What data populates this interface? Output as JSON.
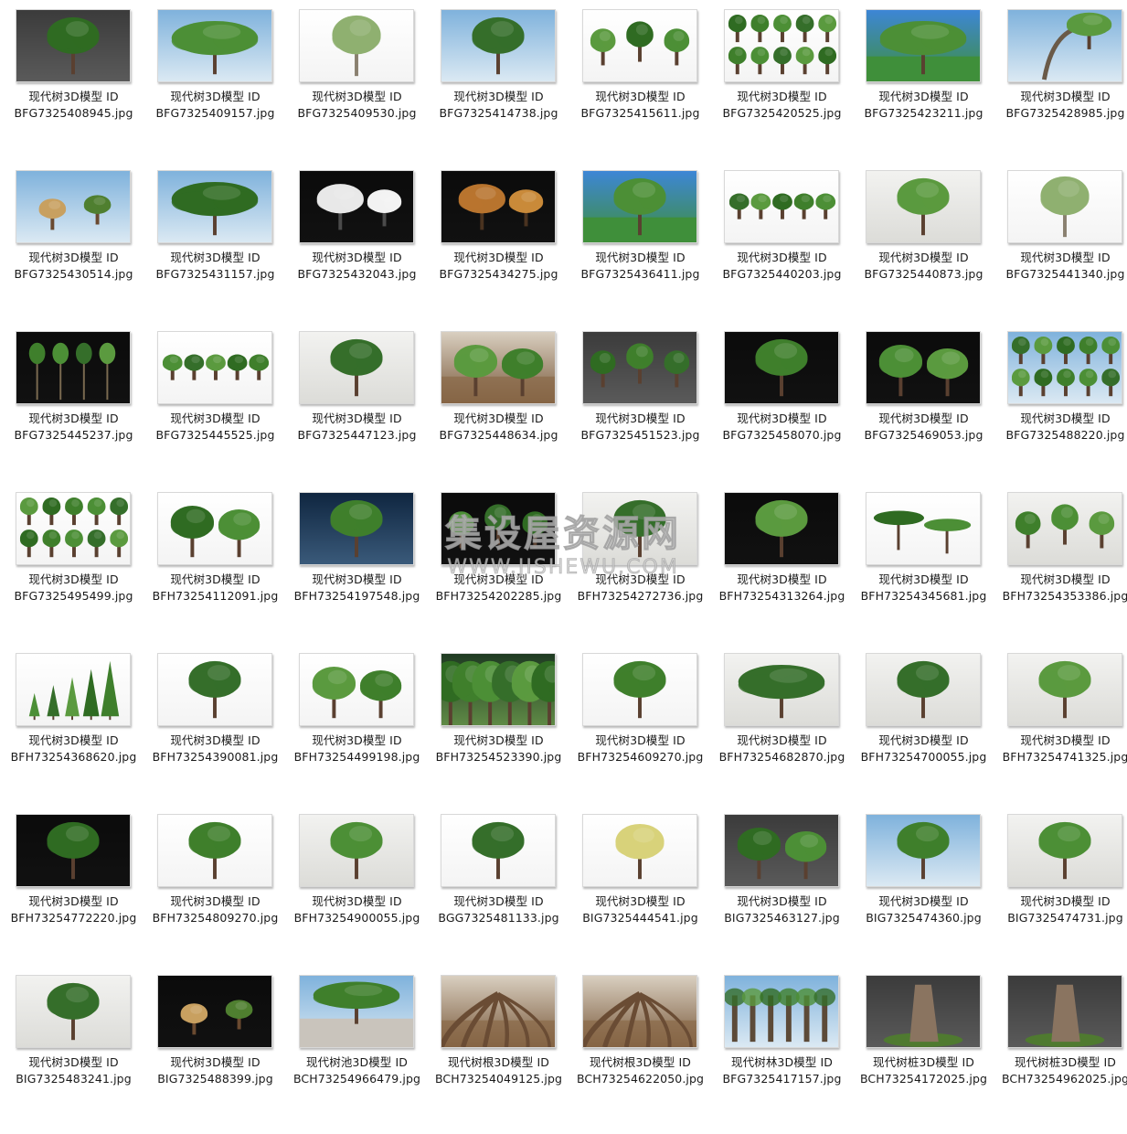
{
  "watermark": {
    "main": "集设屋资源网",
    "url": "WWW.JISHEWU.COM"
  },
  "files": [
    {
      "title": "现代树3D模型 ID",
      "filename": "BFG7325408945.jpg",
      "bg": "dark-grey",
      "tree": "single"
    },
    {
      "title": "现代树3D模型 ID",
      "filename": "BFG7325409157.jpg",
      "bg": "sky",
      "tree": "wide"
    },
    {
      "title": "现代树3D模型 ID",
      "filename": "BFG7325409530.jpg",
      "bg": "white",
      "tree": "willow"
    },
    {
      "title": "现代树3D模型 ID",
      "filename": "BFG7325414738.jpg",
      "bg": "sky",
      "tree": "single"
    },
    {
      "title": "现代树3D模型 ID",
      "filename": "BFG7325415611.jpg",
      "bg": "white",
      "tree": "three"
    },
    {
      "title": "现代树3D模型 ID",
      "filename": "BFG7325420525.jpg",
      "bg": "white",
      "tree": "many"
    },
    {
      "title": "现代树3D模型 ID",
      "filename": "BFG7325423211.jpg",
      "bg": "green-sky",
      "tree": "wide"
    },
    {
      "title": "现代树3D模型 ID",
      "filename": "BFG7325428985.jpg",
      "bg": "sky",
      "tree": "arch"
    },
    {
      "title": "现代树3D模型 ID",
      "filename": "BFG7325430514.jpg",
      "bg": "sky",
      "tree": "bonsai"
    },
    {
      "title": "现代树3D模型 ID",
      "filename": "BFG7325431157.jpg",
      "bg": "sky",
      "tree": "wide"
    },
    {
      "title": "现代树3D模型 ID",
      "filename": "BFG7325432043.jpg",
      "bg": "black",
      "tree": "blossom"
    },
    {
      "title": "现代树3D模型 ID",
      "filename": "BFG7325434275.jpg",
      "bg": "black",
      "tree": "autumn"
    },
    {
      "title": "现代树3D模型 ID",
      "filename": "BFG7325436411.jpg",
      "bg": "green-sky",
      "tree": "single"
    },
    {
      "title": "现代树3D模型 ID",
      "filename": "BFG7325440203.jpg",
      "bg": "white",
      "tree": "row"
    },
    {
      "title": "现代树3D模型 ID",
      "filename": "BFG7325440873.jpg",
      "bg": "light",
      "tree": "single"
    },
    {
      "title": "现代树3D模型 ID",
      "filename": "BFG7325441340.jpg",
      "bg": "white",
      "tree": "willow"
    },
    {
      "title": "现代树3D模型 ID",
      "filename": "BFG7325445237.jpg",
      "bg": "black",
      "tree": "tall"
    },
    {
      "title": "现代树3D模型 ID",
      "filename": "BFG7325445525.jpg",
      "bg": "white",
      "tree": "row"
    },
    {
      "title": "现代树3D模型 ID",
      "filename": "BFG7325447123.jpg",
      "bg": "light",
      "tree": "single"
    },
    {
      "title": "现代树3D模型 ID",
      "filename": "BFG7325448634.jpg",
      "bg": "brown",
      "tree": "two"
    },
    {
      "title": "现代树3D模型 ID",
      "filename": "BFG7325451523.jpg",
      "bg": "dark-grey",
      "tree": "three"
    },
    {
      "title": "现代树3D模型 ID",
      "filename": "BFG7325458070.jpg",
      "bg": "black",
      "tree": "single"
    },
    {
      "title": "现代树3D模型 ID",
      "filename": "BFG7325469053.jpg",
      "bg": "black",
      "tree": "two"
    },
    {
      "title": "现代树3D模型 ID",
      "filename": "BFG7325488220.jpg",
      "bg": "sky",
      "tree": "many"
    },
    {
      "title": "现代树3D模型 ID",
      "filename": "BFG7325495499.jpg",
      "bg": "white",
      "tree": "many"
    },
    {
      "title": "现代树3D模型 ID",
      "filename": "BFH73254112091.jpg",
      "bg": "white",
      "tree": "two"
    },
    {
      "title": "现代树3D模型 ID",
      "filename": "BFH73254197548.jpg",
      "bg": "night",
      "tree": "single"
    },
    {
      "title": "现代树3D模型 ID",
      "filename": "BFH73254202285.jpg",
      "bg": "black",
      "tree": "three"
    },
    {
      "title": "现代树3D模型 ID",
      "filename": "BFH73254272736.jpg",
      "bg": "light",
      "tree": "single"
    },
    {
      "title": "现代树3D模型 ID",
      "filename": "BFH73254313264.jpg",
      "bg": "black",
      "tree": "single"
    },
    {
      "title": "现代树3D模型 ID",
      "filename": "BFH73254345681.jpg",
      "bg": "white",
      "tree": "acacia"
    },
    {
      "title": "现代树3D模型 ID",
      "filename": "BFH73254353386.jpg",
      "bg": "light",
      "tree": "three"
    },
    {
      "title": "现代树3D模型 ID",
      "filename": "BFH73254368620.jpg",
      "bg": "white",
      "tree": "conifer"
    },
    {
      "title": "现代树3D模型 ID",
      "filename": "BFH73254390081.jpg",
      "bg": "white",
      "tree": "single"
    },
    {
      "title": "现代树3D模型 ID",
      "filename": "BFH73254499198.jpg",
      "bg": "white",
      "tree": "two"
    },
    {
      "title": "现代树3D模型 ID",
      "filename": "BFH73254523390.jpg",
      "bg": "jungle",
      "tree": "dense"
    },
    {
      "title": "现代树3D模型 ID",
      "filename": "BFH73254609270.jpg",
      "bg": "white",
      "tree": "single"
    },
    {
      "title": "现代树3D模型 ID",
      "filename": "BFH73254682870.jpg",
      "bg": "light",
      "tree": "wide"
    },
    {
      "title": "现代树3D模型 ID",
      "filename": "BFH73254700055.jpg",
      "bg": "light",
      "tree": "single"
    },
    {
      "title": "现代树3D模型 ID",
      "filename": "BFH73254741325.jpg",
      "bg": "light",
      "tree": "single"
    },
    {
      "title": "现代树3D模型 ID",
      "filename": "BFH73254772220.jpg",
      "bg": "black",
      "tree": "single"
    },
    {
      "title": "现代树3D模型 ID",
      "filename": "BFH73254809270.jpg",
      "bg": "white",
      "tree": "single"
    },
    {
      "title": "现代树3D模型 ID",
      "filename": "BFH73254900055.jpg",
      "bg": "light",
      "tree": "single"
    },
    {
      "title": "现代树3D模型 ID",
      "filename": "BGG7325481133.jpg",
      "bg": "white",
      "tree": "single"
    },
    {
      "title": "现代树3D模型 ID",
      "filename": "BIG7325444541.jpg",
      "bg": "white",
      "tree": "yellow"
    },
    {
      "title": "现代树3D模型 ID",
      "filename": "BIG7325463127.jpg",
      "bg": "dark-grey",
      "tree": "two"
    },
    {
      "title": "现代树3D模型 ID",
      "filename": "BIG7325474360.jpg",
      "bg": "sky",
      "tree": "single"
    },
    {
      "title": "现代树3D模型 ID",
      "filename": "BIG7325474731.jpg",
      "bg": "light",
      "tree": "single"
    },
    {
      "title": "现代树3D模型 ID",
      "filename": "BIG7325483241.jpg",
      "bg": "light",
      "tree": "single"
    },
    {
      "title": "现代树3D模型 ID",
      "filename": "BIG7325488399.jpg",
      "bg": "black",
      "tree": "bonsai"
    },
    {
      "title": "现代树池3D模型 ID",
      "filename": "BCH73254966479.jpg",
      "bg": "sky",
      "tree": "plaza"
    },
    {
      "title": "现代树根3D模型 ID",
      "filename": "BCH73254049125.jpg",
      "bg": "brown",
      "tree": "roots"
    },
    {
      "title": "现代树根3D模型 ID",
      "filename": "BCH73254622050.jpg",
      "bg": "brown",
      "tree": "roots"
    },
    {
      "title": "现代树林3D模型 ID",
      "filename": "BFG7325417157.jpg",
      "bg": "sky",
      "tree": "forest"
    },
    {
      "title": "现代树桩3D模型 ID",
      "filename": "BCH73254172025.jpg",
      "bg": "dark-grey",
      "tree": "stump"
    },
    {
      "title": "现代树桩3D模型 ID",
      "filename": "BCH73254962025.jpg",
      "bg": "dark-grey",
      "tree": "stump"
    }
  ]
}
